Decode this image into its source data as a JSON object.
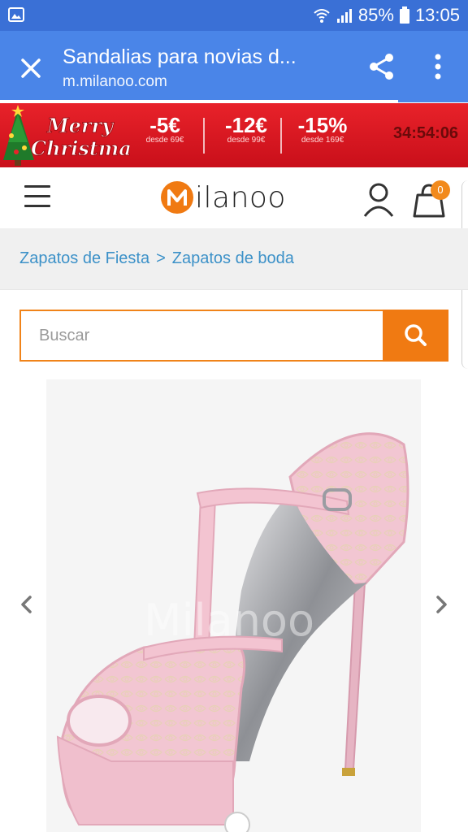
{
  "status_bar": {
    "battery": "85%",
    "time": "13:05"
  },
  "browser": {
    "title": "Sandalias para novias d...",
    "url": "m.milanoo.com"
  },
  "promo": {
    "greeting_line1": "Merry",
    "greeting_line2": "Christmas",
    "deals": [
      {
        "amount": "-5€",
        "min": "desde 69€"
      },
      {
        "amount": "-12€",
        "min": "desde 99€"
      },
      {
        "amount": "-15%",
        "min": "desde 169€"
      }
    ],
    "timer": "34:54:06"
  },
  "header": {
    "logo_text": "ilanoo",
    "cart_count": "0"
  },
  "breadcrumb": {
    "items": [
      "Zapatos de Fiesta",
      "Zapatos de boda"
    ],
    "separator": ">"
  },
  "search": {
    "placeholder": "Buscar"
  },
  "product": {
    "watermark": "Milanoo"
  },
  "colors": {
    "status_bar": "#3a70d6",
    "browser_bar": "#4a85e8",
    "accent": "#f07a12",
    "link": "#3c91c8",
    "promo_red": "#e8222a"
  }
}
